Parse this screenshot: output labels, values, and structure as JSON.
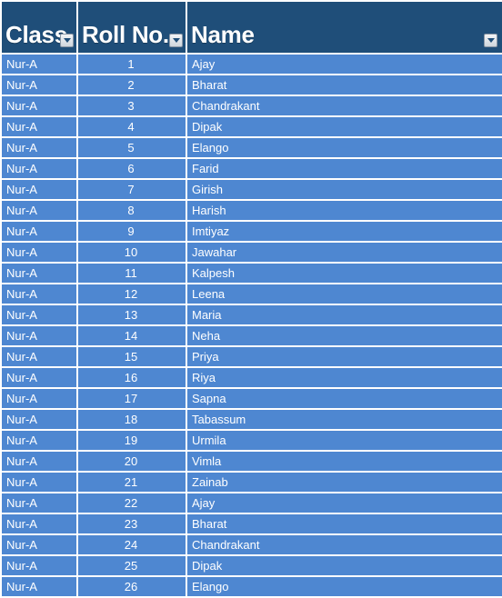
{
  "table": {
    "columns": [
      {
        "key": "class",
        "label": "Class",
        "align": "left",
        "filter_icon": "filter-dropdown-icon"
      },
      {
        "key": "roll_no",
        "label": "Roll No.",
        "align": "center",
        "filter_icon": "filter-dropdown-icon"
      },
      {
        "key": "name",
        "label": "Name",
        "align": "left",
        "filter_icon": "filter-dropdown-icon"
      }
    ],
    "colors": {
      "header_background": "#1F4E79",
      "header_text": "#FFFFFF",
      "row_background": "#4E87D1",
      "row_text": "#FFFFFF",
      "gridline": "#FFFFFF",
      "filter_button_face": "#DCE2E8",
      "filter_button_arrow": "#1F4E79"
    },
    "rows": [
      {
        "class": "Nur-A",
        "roll_no": "1",
        "name": "Ajay"
      },
      {
        "class": "Nur-A",
        "roll_no": "2",
        "name": "Bharat"
      },
      {
        "class": "Nur-A",
        "roll_no": "3",
        "name": "Chandrakant"
      },
      {
        "class": "Nur-A",
        "roll_no": "4",
        "name": "Dipak"
      },
      {
        "class": "Nur-A",
        "roll_no": "5",
        "name": "Elango"
      },
      {
        "class": "Nur-A",
        "roll_no": "6",
        "name": "Farid"
      },
      {
        "class": "Nur-A",
        "roll_no": "7",
        "name": "Girish"
      },
      {
        "class": "Nur-A",
        "roll_no": "8",
        "name": "Harish"
      },
      {
        "class": "Nur-A",
        "roll_no": "9",
        "name": "Imtiyaz"
      },
      {
        "class": "Nur-A",
        "roll_no": "10",
        "name": "Jawahar"
      },
      {
        "class": "Nur-A",
        "roll_no": "11",
        "name": "Kalpesh"
      },
      {
        "class": "Nur-A",
        "roll_no": "12",
        "name": "Leena"
      },
      {
        "class": "Nur-A",
        "roll_no": "13",
        "name": "Maria"
      },
      {
        "class": "Nur-A",
        "roll_no": "14",
        "name": "Neha"
      },
      {
        "class": "Nur-A",
        "roll_no": "15",
        "name": "Priya"
      },
      {
        "class": "Nur-A",
        "roll_no": "16",
        "name": "Riya"
      },
      {
        "class": "Nur-A",
        "roll_no": "17",
        "name": "Sapna"
      },
      {
        "class": "Nur-A",
        "roll_no": "18",
        "name": "Tabassum"
      },
      {
        "class": "Nur-A",
        "roll_no": "19",
        "name": "Urmila"
      },
      {
        "class": "Nur-A",
        "roll_no": "20",
        "name": "Vimla"
      },
      {
        "class": "Nur-A",
        "roll_no": "21",
        "name": "Zainab"
      },
      {
        "class": "Nur-A",
        "roll_no": "22",
        "name": "Ajay"
      },
      {
        "class": "Nur-A",
        "roll_no": "23",
        "name": "Bharat"
      },
      {
        "class": "Nur-A",
        "roll_no": "24",
        "name": "Chandrakant"
      },
      {
        "class": "Nur-A",
        "roll_no": "25",
        "name": "Dipak"
      },
      {
        "class": "Nur-A",
        "roll_no": "26",
        "name": "Elango"
      }
    ]
  }
}
